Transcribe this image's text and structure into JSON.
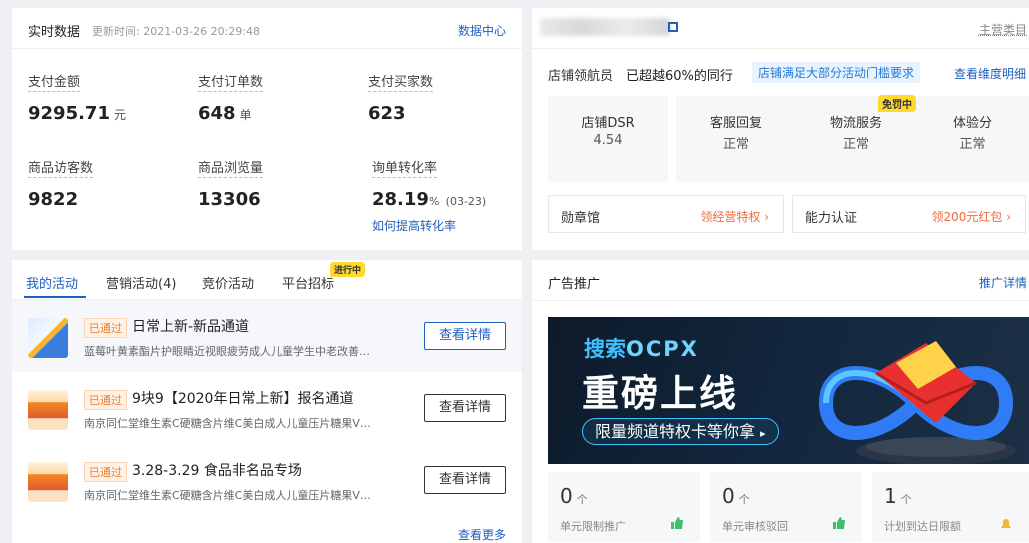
{
  "realtime": {
    "title": "实时数据",
    "update_time": "更新时间: 2021-03-26 20:29:48",
    "link": "数据中心",
    "metrics": [
      {
        "label": "支付金额",
        "value": "9295.71",
        "unit": "元",
        "note": ""
      },
      {
        "label": "支付订单数",
        "value": "648",
        "unit": "单",
        "note": ""
      },
      {
        "label": "支付买家数",
        "value": "623",
        "unit": "",
        "note": ""
      },
      {
        "label": "商品访客数",
        "value": "9822",
        "unit": "",
        "note": ""
      },
      {
        "label": "商品浏览量",
        "value": "13306",
        "unit": "",
        "note": ""
      },
      {
        "label": "询单转化率",
        "value": "28.19",
        "unit": "%",
        "note": "(03-23)"
      }
    ],
    "improve_link": "如何提高转化率"
  },
  "store": {
    "main_category": "主营类目",
    "navigator_label": "店铺领航员",
    "surpass": "已超越60%的同行",
    "tag": "店铺满足大部分活动门槛要求",
    "dimension_link": "查看维度明细",
    "scores": [
      {
        "label": "店铺DSR",
        "value": "4.54",
        "badge": ""
      },
      {
        "label": "客服回复",
        "value": "正常",
        "badge": ""
      },
      {
        "label": "物流服务",
        "value": "正常",
        "badge": "免罚中"
      },
      {
        "label": "体验分",
        "value": "正常",
        "badge": ""
      }
    ],
    "medal": {
      "label": "勋章馆",
      "action": "领经营特权 ›"
    },
    "capability": {
      "label": "能力认证",
      "action": "领200元红包 ›"
    }
  },
  "activities": {
    "tabs": [
      {
        "label": "我的活动",
        "badge": ""
      },
      {
        "label": "营销活动(4)",
        "badge": ""
      },
      {
        "label": "竞价活动",
        "badge": ""
      },
      {
        "label": "平台招标",
        "badge": "进行中"
      }
    ],
    "items": [
      {
        "status": "已通过",
        "title": "日常上新-新品通道",
        "desc": "蓝莓叶黄素酯片护眼睛近视眼疲劳成人儿童学生中老改善…",
        "button": "查看详情"
      },
      {
        "status": "已通过",
        "title": "9块9【2020年日常上新】报名通道",
        "desc": "南京同仁堂维生素C硬糖含片维C美白成人儿童压片糖果V…",
        "button": "查看详情"
      },
      {
        "status": "已通过",
        "title": "3.28-3.29 食品非名品专场",
        "desc": "南京同仁堂维生素C硬糖含片维C美白成人儿童压片糖果V…",
        "button": "查看详情"
      }
    ],
    "more": "查看更多"
  },
  "ads": {
    "title": "广告推广",
    "link": "推广详情",
    "banner": {
      "line1a": "搜索",
      "line1b": "OCPX",
      "line2": "重磅上线",
      "pill": "限量频道特权卡等你拿"
    },
    "stats": [
      {
        "value": "0",
        "unit": "个",
        "label": "单元限制推广"
      },
      {
        "value": "0",
        "unit": "个",
        "label": "单元审核驳回"
      },
      {
        "value": "1",
        "unit": "个",
        "label": "计划到达日限额"
      }
    ]
  },
  "colors": {
    "accent": "#1f5fbf",
    "warning": "#f07a2a",
    "badge": "#ffd92b",
    "banner_bg": "#0f1e2e"
  }
}
